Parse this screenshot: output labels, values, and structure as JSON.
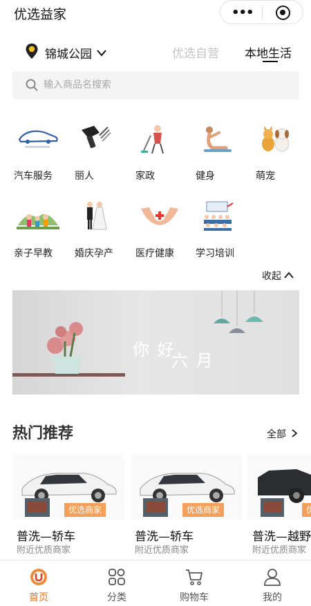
{
  "app": {
    "title": "优选益家"
  },
  "location": {
    "name": "锦城公园"
  },
  "top_tabs": [
    {
      "label": "优选自营",
      "active": false
    },
    {
      "label": "本地生活",
      "active": true
    }
  ],
  "search": {
    "placeholder": "输入商品名搜索",
    "value": ""
  },
  "categories": [
    {
      "label": "汽车服务",
      "icon": "car-logo-icon"
    },
    {
      "label": "丽人",
      "icon": "hair-dryer-icon"
    },
    {
      "label": "家政",
      "icon": "housekeeping-icon"
    },
    {
      "label": "健身",
      "icon": "yoga-icon"
    },
    {
      "label": "萌宠",
      "icon": "pets-icon"
    },
    {
      "label": "亲子早教",
      "icon": "family-icon"
    },
    {
      "label": "婚庆孕产",
      "icon": "wedding-couple-icon"
    },
    {
      "label": "医疗健康",
      "icon": "medical-hands-icon"
    },
    {
      "label": "学习培训",
      "icon": "classroom-icon"
    }
  ],
  "collapse_label": "收起",
  "banner": {
    "text_line1": "你 好",
    "text_line2": "六 月"
  },
  "hot": {
    "title": "热门推荐",
    "all_label": "全部",
    "items": [
      {
        "badge": "优选商家",
        "name": "普洗—轿车",
        "sub": "附近优质商家"
      },
      {
        "badge": "优选商家",
        "name": "普洗—轿车",
        "sub": "附近优质商家"
      },
      {
        "badge": "优选商家",
        "name": "普洗—越野",
        "sub": "附近优质商家"
      }
    ]
  },
  "tabbar": [
    {
      "label": "首页",
      "icon": "home-logo-icon",
      "active": true
    },
    {
      "label": "分类",
      "icon": "grid-icon",
      "active": false
    },
    {
      "label": "购物车",
      "icon": "cart-icon",
      "active": false
    },
    {
      "label": "我的",
      "icon": "user-icon",
      "active": false
    }
  ],
  "colors": {
    "accent": "#f0721e",
    "badge": "#f4a05a",
    "tab_inactive": "#c4c4c4"
  }
}
